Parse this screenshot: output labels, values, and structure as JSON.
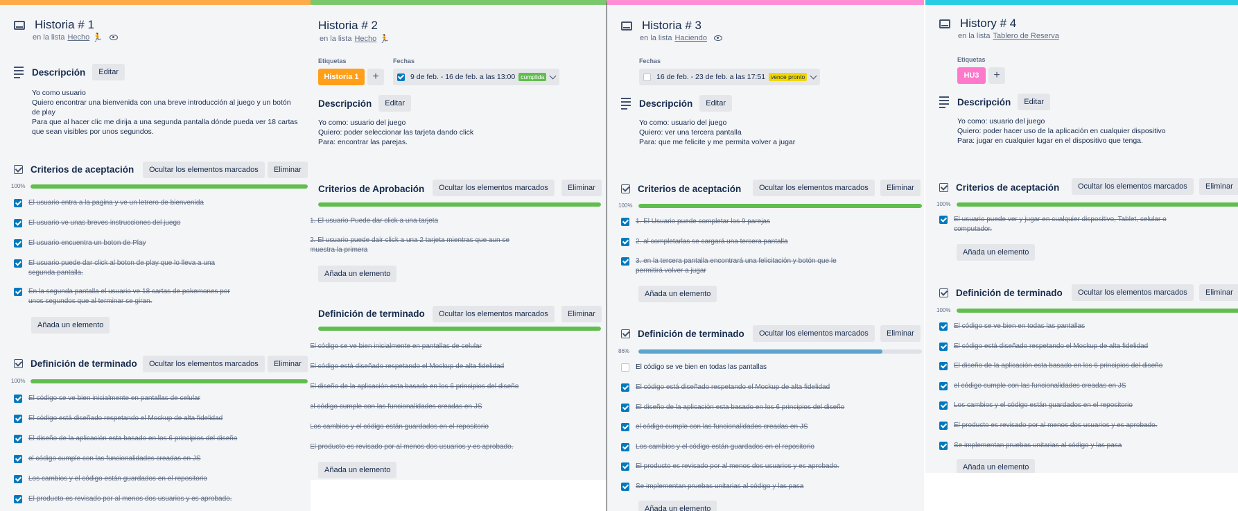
{
  "colors": {
    "orange": "#ffab4a",
    "green": "#7bc86c",
    "pink": "#ff8ed4",
    "cyan": "#29cce5",
    "checkbox": "#0079bf",
    "progress_green": "#61bd4f",
    "progress_blue": "#5ba4cf"
  },
  "icons": [
    "card-icon",
    "eye-icon",
    "description-icon",
    "checklist-icon",
    "plus-icon",
    "chevron-down-icon"
  ],
  "common": {
    "edit": "Editar",
    "hide_checked": "Ocultar los elementos marcados",
    "delete": "Eliminar",
    "add_item": "Añada un elemento",
    "in_list": "en la lista",
    "description": "Descripción",
    "labels": "Etiquetas",
    "dates": "Fechas",
    "plus": "+"
  },
  "card1": {
    "title": "Historia # 1",
    "list": "Hecho",
    "list_emoji": "🏃",
    "desc": [
      "Yo como usuario",
      "Quiero encontrar una bienvenida con una breve introducción al juego y un botón",
      "de play",
      "Para que al hacer clic me dirija a una segunda pantalla dónde pueda ver 18 cartas",
      "que sean visibles por unos segundos."
    ],
    "checklist1": {
      "title": "Criterios de aceptación",
      "percent": "100%",
      "progress": 1.0,
      "items": [
        [
          "El usuario entra a la pagina y ve un letrero de bienvenida"
        ],
        [
          "El usuario ve unas breves instrucciones del juego"
        ],
        [
          "El usuario encuentra un boton de Play"
        ],
        [
          "El usuario puede dar click al boton de play que lo lleva a una",
          "segunda pantalla."
        ],
        [
          "En la segunda pantalla el usuario ve 18 cartas de pokemones por",
          "unos segundos que al terminar se giran."
        ]
      ]
    },
    "checklist2": {
      "title": "Definición de terminado",
      "percent": "100%",
      "progress": 1.0,
      "items": [
        "El código se ve bien inicialmente en pantallas de celular",
        "El código está diseñado respetando el Mockup de alta fidelidad",
        "El diseño de la aplicación esta basado en los 6 principios del diseño",
        "el código cumple con las funcionalidades creadas en JS",
        "Los cambios y el código están guardados en el repositorio",
        "El producto es revisado por al menos dos usuarios y es aprobado."
      ]
    }
  },
  "card2": {
    "title": "Historia # 2",
    "list": "Hecho",
    "list_emoji": "🏃",
    "label": "Historia 1",
    "label_color": "#ff9f1a",
    "date": "9 de feb. - 16 de feb. a las 13:00",
    "date_badge": "cumplida",
    "desc": [
      "Yo como: usuario del juego",
      "Quiero: poder seleccionar las tarjeta dando click",
      "Para: encontrar las parejas."
    ],
    "checklist1": {
      "title": "Criterios de Aprobación",
      "progress": 1.0,
      "items": [
        [
          "1. El usuario Puede dar click a una tarjeta"
        ],
        [
          "2. El usuario puede dair click a una 2 tarjeta mientras que aun se",
          "muestra la primera"
        ]
      ]
    },
    "checklist2": {
      "title": "Definición de terminado",
      "progress": 1.0,
      "items": [
        "El código se ve bien inicialmente en pantallas de celular",
        "El código está diseñado respetando el Mockup de alta fidelidad",
        "El diseño de la aplicación esta basado en los 6 principios del diseño",
        "el código cumple con las funcionalidades creadas en JS",
        "Los cambios y el código están guardados en el repositorio",
        "El producto es revisado por al menos dos usuarios y es aprobado."
      ]
    }
  },
  "card3": {
    "title": "Historia # 3",
    "list": "Haciendo",
    "date": "16 de feb. - 23 de feb. a las 17:51",
    "date_badge": "vence pronto",
    "desc": [
      "Yo como: usuario del juego",
      "Quiero: ver una tercera pantalla",
      "Para: que me felicite y me permita volver a jugar"
    ],
    "checklist1": {
      "title": "Criterios de aceptación",
      "percent": "100%",
      "progress": 1.0,
      "items": [
        [
          "1. El Usuario puede completar los 9 parejas"
        ],
        [
          "2. al completarlas se cargará una tercera pantalla"
        ],
        [
          "3. en la tercera pantalla encontrará una felicitación y botón que le",
          "permitirá volver a jugar"
        ]
      ]
    },
    "checklist2": {
      "title": "Definición de terminado",
      "percent": "86%",
      "progress": 0.86,
      "items": [
        "El código se ve bien en todas las pantallas",
        "El código está diseñado respetando el Mockup de alta fidelidad",
        "El diseño de la aplicación esta basado en los 6 principios del diseño",
        "el código cumple con las funcionalidades creadas en JS",
        "Los cambios y el código están guardados en el repositorio",
        "El producto es revisado por al menos dos usuarios y es aprobado.",
        "Se implementan pruebas unitarias al código y las pasa"
      ],
      "checked": [
        false,
        true,
        true,
        true,
        true,
        true,
        true
      ]
    }
  },
  "card4": {
    "title": "History # 4",
    "list": "Tablero de Reserva",
    "label": "HU3",
    "label_color": "#ff78cb",
    "desc": [
      "Yo como: usuario del juego",
      "Quiero: poder hacer uso de la aplicación en cualquier dispositivo",
      "Para: jugar en cualquier lugar en el dispositivo que tenga."
    ],
    "checklist1": {
      "title": "Criterios de aceptación",
      "percent": "100%",
      "progress": 1.0,
      "items": [
        [
          "El usuario puede ver y jugar en cualquier dispositivo, Tablet, celular o",
          "computador."
        ]
      ]
    },
    "checklist2": {
      "title": "Definición de terminado",
      "percent": "100%",
      "progress": 1.0,
      "items": [
        "El código se ve bien en todas las pantallas",
        "El código está diseñado respetando el Mockup de alta fidelidad",
        "El diseño de la aplicación esta basado en los 6 principios del diseño",
        "el código cumple con las funcionalidades creadas en JS",
        "Los cambios y el código están guardados en el repositorio",
        "El producto es revisado por al menos dos usuarios y es aprobado.",
        "Se implementan pruebas unitarias al código y las pasa"
      ]
    }
  }
}
